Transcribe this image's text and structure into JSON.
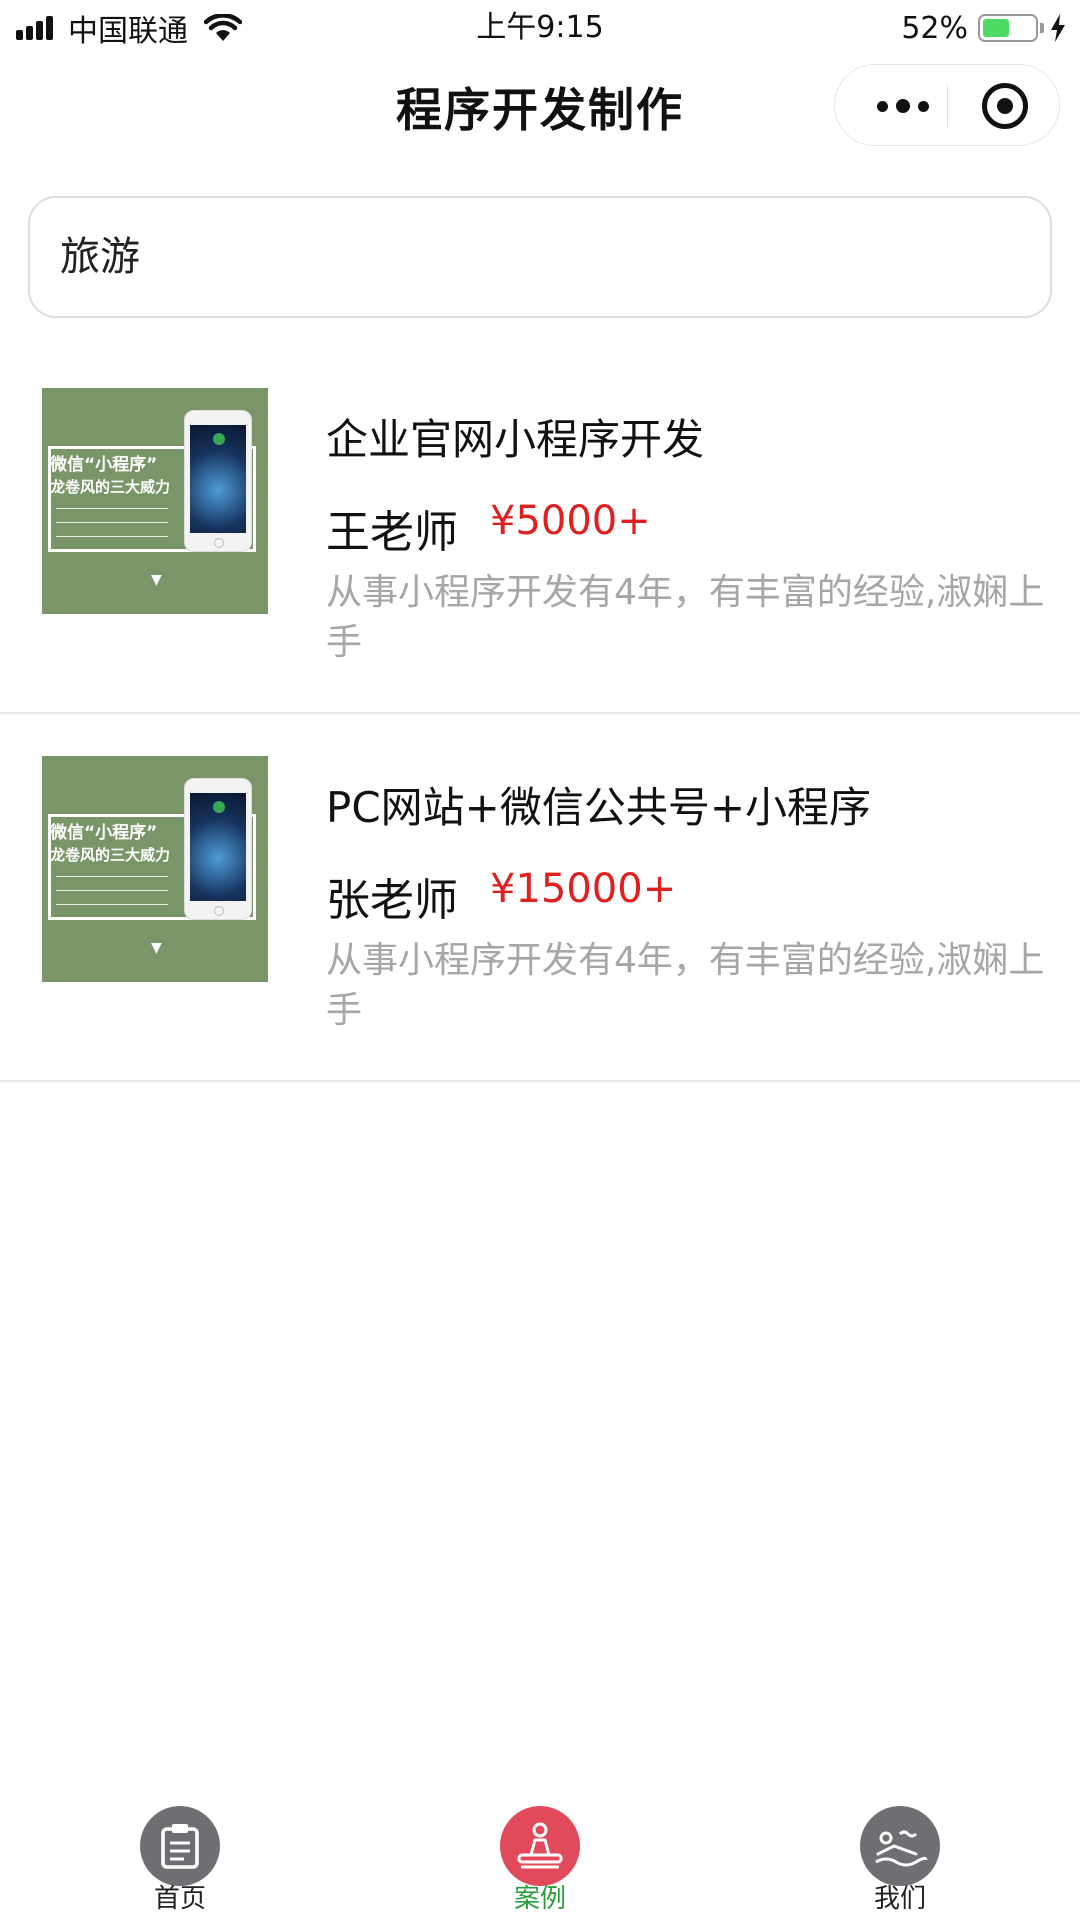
{
  "status_bar": {
    "carrier": "中国联通",
    "time": "上午9:15",
    "battery": "52%",
    "battery_level": 0.52,
    "icons": [
      "signal-icon",
      "wifi-icon",
      "battery-icon",
      "charging-icon"
    ]
  },
  "nav": {
    "title": "程序开发制作",
    "icons": [
      "more-icon",
      "close-icon"
    ]
  },
  "search": {
    "value": "旅游"
  },
  "items": [
    {
      "title": "企业官网小程序开发",
      "teacher": "王老师",
      "price": "¥5000+",
      "description": "从事小程序开发有4年，有丰富的经验,淑娴上手"
    },
    {
      "title": "PC网站+微信公共号+小程序",
      "teacher": "张老师",
      "price": "¥15000+",
      "description": "从事小程序开发有4年，有丰富的经验,淑娴上手"
    }
  ],
  "thumbnail": {
    "line1": "微信“小程序”",
    "line2": "龙卷风的三大威力"
  },
  "tabs": [
    {
      "label": "首页",
      "icon": "clipboard-icon",
      "active": false
    },
    {
      "label": "案例",
      "icon": "massage-icon",
      "active": true
    },
    {
      "label": "我们",
      "icon": "spa-icon",
      "active": false
    }
  ],
  "colors": {
    "price": "#e02020",
    "active_tab": "#2a9d3a",
    "thumbnail_bg": "#7a9568",
    "active_tab_icon": "#e14a5a",
    "inactive_tab_icon": "#6f6f73"
  }
}
